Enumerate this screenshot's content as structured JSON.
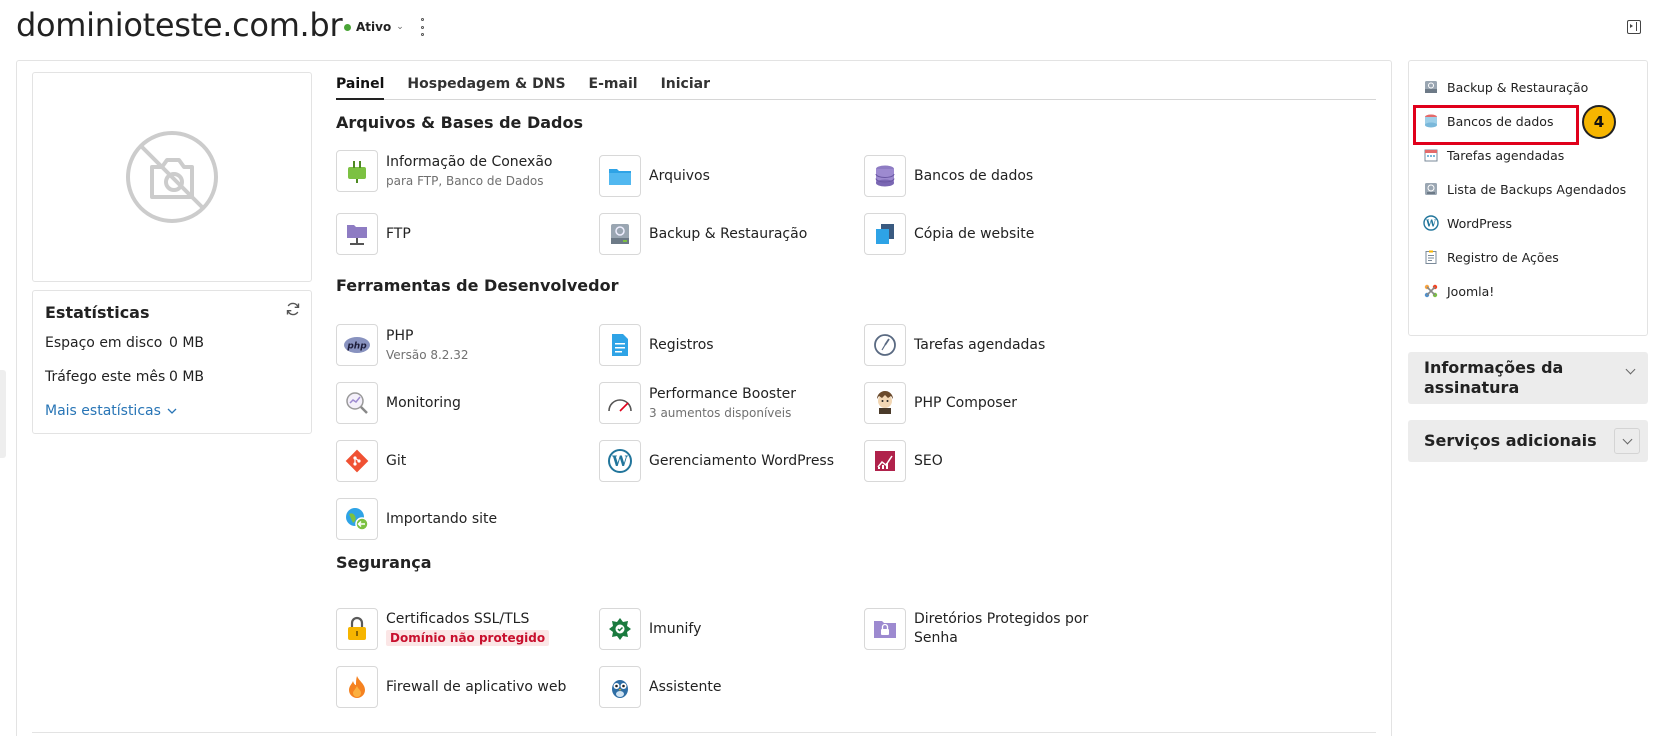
{
  "header": {
    "domain": "dominioteste.com.br",
    "status": "Ativo"
  },
  "tabs": [
    {
      "label": "Painel"
    },
    {
      "label": "Hospedagem & DNS"
    },
    {
      "label": "E-mail"
    },
    {
      "label": "Iniciar"
    }
  ],
  "stats": {
    "title": "Estatísticas",
    "disk_label": "Espaço em disco",
    "disk_value": "0 MB",
    "traffic_label": "Tráfego este mês",
    "traffic_value": "0 MB",
    "more_label": "Mais estatísticas"
  },
  "sections": {
    "files_title": "Arquivos & Bases de Dados",
    "dev_title": "Ferramentas de Desenvolvedor",
    "security_title": "Segurança"
  },
  "tiles": {
    "connection": {
      "label": "Informação de Conexão",
      "sub": "para FTP, Banco de Dados"
    },
    "files": {
      "label": "Arquivos"
    },
    "databases": {
      "label": "Bancos de dados"
    },
    "ftp": {
      "label": "FTP"
    },
    "backup": {
      "label": "Backup & Restauração"
    },
    "copy_site": {
      "label": "Cópia de website"
    },
    "php": {
      "label": "PHP",
      "sub": "Versão 8.2.32"
    },
    "logs": {
      "label": "Registros"
    },
    "scheduled": {
      "label": "Tarefas agendadas"
    },
    "monitoring": {
      "label": "Monitoring"
    },
    "performance": {
      "label": "Performance Booster",
      "sub": "3 aumentos disponíveis"
    },
    "composer": {
      "label": "PHP Composer"
    },
    "git": {
      "label": "Git"
    },
    "wordpress": {
      "label": "Gerenciamento WordPress"
    },
    "seo": {
      "label": "SEO"
    },
    "import": {
      "label": "Importando site"
    },
    "ssl": {
      "label": "Certificados SSL/TLS",
      "badge": "Domínio não protegido"
    },
    "imunify": {
      "label": "Imunify"
    },
    "protected_dirs": {
      "label": "Diretórios Protegidos por",
      "label2": "Senha"
    },
    "firewall": {
      "label": "Firewall de aplicativo web"
    },
    "assistant": {
      "label": "Assistente"
    }
  },
  "sidebar": {
    "items": [
      {
        "label": "Backup & Restauração"
      },
      {
        "label": "Bancos de dados"
      },
      {
        "label": "Tarefas agendadas"
      },
      {
        "label": "Lista de Backups Agendados"
      },
      {
        "label": "WordPress"
      },
      {
        "label": "Registro de Ações"
      },
      {
        "label": "Joomla!"
      }
    ],
    "step_badge": "4",
    "subscription_line1": "Informações da",
    "subscription_line2": "assinatura",
    "additional_services": "Serviços adicionais"
  },
  "colors": {
    "status_green": "#4aa537",
    "link_blue": "#2875b6",
    "highlight_red": "#e0001b",
    "badge_orange": "#f6b500"
  }
}
